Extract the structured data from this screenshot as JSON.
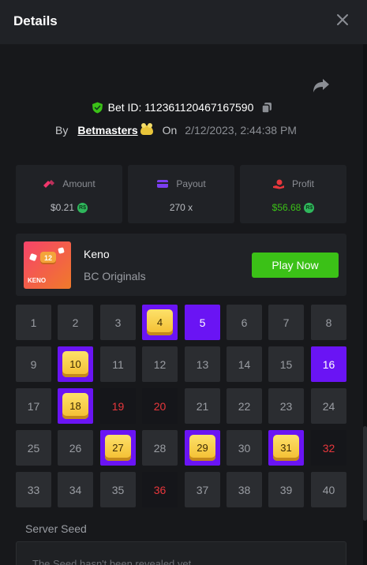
{
  "header": {
    "title": "Details",
    "close_icon": "close-icon"
  },
  "share_icon": "share-icon",
  "bet": {
    "id_label": "Bet ID: 112361120467167590",
    "by_label": "By",
    "user": "Betmasters",
    "on_label": "On",
    "date": "2/12/2023, 2:44:38 PM"
  },
  "stats": {
    "amount": {
      "label": "Amount",
      "value": "$0.21",
      "icon": "coins-icon"
    },
    "payout": {
      "label": "Payout",
      "value": "270 x",
      "icon": "wallet-icon"
    },
    "profit": {
      "label": "Profit",
      "value": "$56.68",
      "icon": "hand-coin-icon"
    }
  },
  "coin_symbol": "R$",
  "game": {
    "name": "Keno",
    "provider": "BC Originals",
    "thumb_ball": "12",
    "thumb_label": "KENO",
    "play_label": "Play Now"
  },
  "grid_numbers": [
    "1",
    "2",
    "3",
    "4",
    "5",
    "6",
    "7",
    "8",
    "9",
    "10",
    "11",
    "12",
    "13",
    "14",
    "15",
    "16",
    "17",
    "18",
    "19",
    "20",
    "21",
    "22",
    "23",
    "24",
    "25",
    "26",
    "27",
    "28",
    "29",
    "30",
    "31",
    "32",
    "33",
    "34",
    "35",
    "36",
    "37",
    "38",
    "39",
    "40"
  ],
  "grid_matches": [
    4,
    10,
    18,
    27,
    29,
    31
  ],
  "grid_hits": [
    5,
    16
  ],
  "grid_misses": [
    19,
    20,
    32,
    36
  ],
  "seed": {
    "label": "Server Seed",
    "value": "The Seed hasn't been revealed yet"
  },
  "colors": {
    "accent_purple": "#6a14f4",
    "play_green": "#3bc117",
    "miss_red": "#e8373c",
    "gem_gold": "#f3bd2f"
  }
}
